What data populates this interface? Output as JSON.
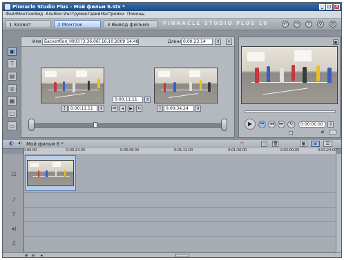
{
  "window": {
    "title": "Pinnacle Studio Plus - Мой фильм 6.stx *"
  },
  "menu": [
    "Файл",
    "Монтаж",
    "Вид",
    "Альбом",
    "Инструментарий",
    "Настройки",
    "Помощь"
  ],
  "tabs": [
    {
      "label": "1 Захват",
      "active": false
    },
    {
      "label": "2 Монтаж",
      "active": true
    },
    {
      "label": "3 Вывод фильма",
      "active": false
    }
  ],
  "brand": "PINNACLE STUDIO PLUS 10",
  "editor": {
    "name_label": "Имя",
    "name_value": "Баскетбол_0003 [3:36.06] 16.10.2009 14:48:36",
    "duration_label": "Длина",
    "duration_value": "0:00:23.14",
    "in_time": "0:00:11.11",
    "center_time": "0:00:11.11",
    "out_time": "0:00:34.24"
  },
  "player": {
    "timecode": "0:00:00.00"
  },
  "timeline": {
    "title": "Мой фильм 6 *",
    "ruler": [
      "0:00.00",
      "0:00:24.00",
      "0:00:48.00",
      "0:01:12.00",
      "0:01:36.00",
      "0:02:00.00",
      "0:02:24.00"
    ]
  },
  "colors": {
    "accent": "#3d6fb4",
    "title_bar": "#1c4a82",
    "playhead": "#d23a2a"
  }
}
